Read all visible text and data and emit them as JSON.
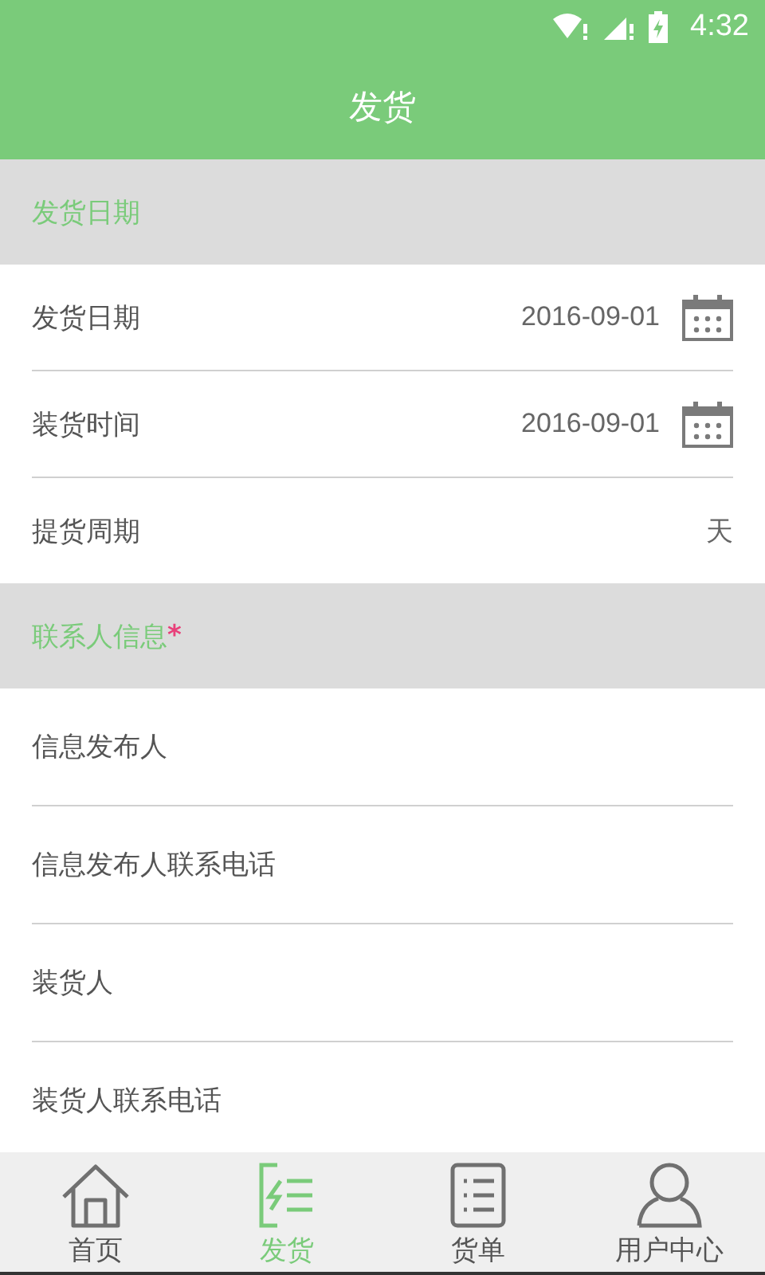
{
  "status_bar": {
    "time": "4:32"
  },
  "title": "发货",
  "sections": [
    {
      "title": "发货日期",
      "rows": [
        {
          "kind": "date",
          "label": "发货日期",
          "value": "2016-09-01"
        },
        {
          "kind": "date",
          "label": "装货时间",
          "value": "2016-09-01"
        },
        {
          "kind": "text",
          "label": "提货周期",
          "value": "天"
        }
      ]
    },
    {
      "title": "联系人信息",
      "marker": "*",
      "rows": [
        {
          "kind": "input",
          "label": "信息发布人"
        },
        {
          "kind": "input",
          "label": "信息发布人联系电话"
        },
        {
          "kind": "input",
          "label": "装货人"
        },
        {
          "kind": "input",
          "label": "装货人联系电话"
        }
      ]
    }
  ],
  "nav": [
    {
      "kind": "home",
      "label": "首页",
      "selected": false
    },
    {
      "kind": "send",
      "label": "发货",
      "selected": true
    },
    {
      "kind": "list",
      "label": "货单",
      "selected": false
    },
    {
      "kind": "user",
      "label": "用户中心",
      "selected": false
    }
  ]
}
